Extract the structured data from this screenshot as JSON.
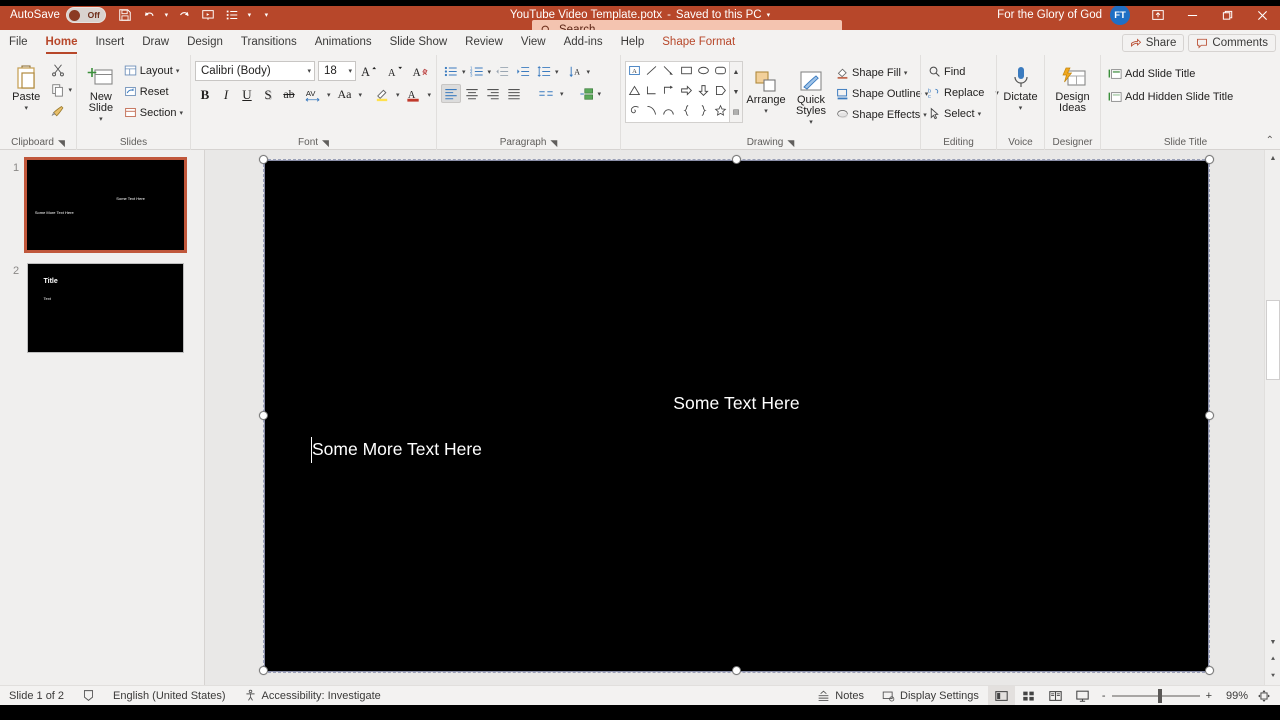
{
  "titlebar": {
    "autosave_label": "AutoSave",
    "autosave_state": "Off",
    "document_title": "YouTube Video Template.potx",
    "save_state": "Saved to this PC",
    "search_placeholder": "Search",
    "account_name": "For the Glory of God",
    "avatar_initials": "FT",
    "accent_color": "#b7472a",
    "qat": [
      {
        "name": "save-icon",
        "label": "Save"
      },
      {
        "name": "undo-icon",
        "label": "Undo"
      },
      {
        "name": "redo-icon",
        "label": "Redo"
      },
      {
        "name": "start-from-beginning-icon",
        "label": "Start From Beginning"
      },
      {
        "name": "customize-list-icon",
        "label": "Customize Quick Access Toolbar"
      }
    ],
    "window_controls": [
      "minimize",
      "restore",
      "close"
    ]
  },
  "tabs": [
    {
      "label": "File",
      "active": false
    },
    {
      "label": "Home",
      "active": true
    },
    {
      "label": "Insert",
      "active": false
    },
    {
      "label": "Draw",
      "active": false
    },
    {
      "label": "Design",
      "active": false
    },
    {
      "label": "Transitions",
      "active": false
    },
    {
      "label": "Animations",
      "active": false
    },
    {
      "label": "Slide Show",
      "active": false
    },
    {
      "label": "Review",
      "active": false
    },
    {
      "label": "View",
      "active": false
    },
    {
      "label": "Add-ins",
      "active": false
    },
    {
      "label": "Help",
      "active": false
    },
    {
      "label": "Shape Format",
      "active": false,
      "contextual": true
    }
  ],
  "tabs_right": {
    "share_label": "Share",
    "comments_label": "Comments"
  },
  "ribbon": {
    "groups": [
      {
        "name": "clipboard",
        "label": "Clipboard"
      },
      {
        "name": "slides",
        "label": "Slides"
      },
      {
        "name": "font",
        "label": "Font"
      },
      {
        "name": "paragraph",
        "label": "Paragraph"
      },
      {
        "name": "drawing",
        "label": "Drawing"
      },
      {
        "name": "editing",
        "label": "Editing"
      },
      {
        "name": "voice",
        "label": "Voice"
      },
      {
        "name": "designer",
        "label": "Designer"
      },
      {
        "name": "slide_title",
        "label": "Slide Title"
      }
    ],
    "clipboard": {
      "paste_label": "Paste",
      "cut_tooltip": "Cut",
      "copy_tooltip": "Copy",
      "format_painter_tooltip": "Format Painter"
    },
    "slides": {
      "new_slide_label": "New Slide",
      "layout_label": "Layout",
      "reset_label": "Reset",
      "section_label": "Section"
    },
    "font": {
      "font_name": "Calibri (Body)",
      "font_size": "18",
      "grow_font_tooltip": "Increase Font Size",
      "shrink_font_tooltip": "Decrease Font Size",
      "clear_formatting_tooltip": "Clear All Formatting",
      "bold": "B",
      "italic": "I",
      "underline": "U",
      "shadow": "S",
      "strikethrough": "ab",
      "char_spacing": "AV",
      "change_case": "Aa",
      "text_highlight_tooltip": "Text Highlight Color",
      "font_color_tooltip": "Font Color"
    },
    "paragraph": {
      "bullets_tooltip": "Bullets",
      "numbering_tooltip": "Numbering",
      "decrease_indent_tooltip": "Decrease List Level",
      "increase_indent_tooltip": "Increase List Level",
      "line_spacing_tooltip": "Line Spacing",
      "text_direction_tooltip": "Text Direction",
      "align_text_tooltip": "Align Text",
      "smartart_tooltip": "Convert to SmartArt",
      "align_left_tooltip": "Align Left",
      "center_tooltip": "Center",
      "align_right_tooltip": "Align Right",
      "justify_tooltip": "Justify",
      "columns_tooltip": "Add or Remove Columns"
    },
    "drawing": {
      "arrange_label": "Arrange",
      "quick_styles_label": "Quick Styles",
      "shape_fill_label": "Shape Fill",
      "shape_outline_label": "Shape Outline",
      "shape_effects_label": "Shape Effects"
    },
    "editing": {
      "find_label": "Find",
      "replace_label": "Replace",
      "select_label": "Select"
    },
    "voice": {
      "dictate_label": "Dictate"
    },
    "designer": {
      "design_ideas_label": "Design Ideas"
    },
    "slide_title": {
      "add_slide_title_label": "Add Slide Title",
      "add_hidden_slide_title_label": "Add Hidden Slide Title"
    }
  },
  "thumbnails": [
    {
      "number": "1",
      "selected": true,
      "text_a": "Some Text Here",
      "text_b": "Some More Text Here"
    },
    {
      "number": "2",
      "selected": false,
      "title": "Title",
      "body": "Text"
    }
  ],
  "slide": {
    "background_color": "#000000",
    "text_a": "Some Text Here",
    "text_b": "Some More Text Here",
    "text_color": "#ffffff",
    "selected": true
  },
  "statusbar": {
    "slide_counter": "Slide 1 of 2",
    "language": "English (United States)",
    "accessibility": "Accessibility: Investigate",
    "notes_label": "Notes",
    "display_settings_label": "Display Settings",
    "zoom_percent": "99%",
    "zoom_out_label": "-",
    "zoom_in_label": "+",
    "views": [
      {
        "name": "normal-view",
        "active": true
      },
      {
        "name": "slide-sorter-view",
        "active": false
      },
      {
        "name": "reading-view",
        "active": false
      },
      {
        "name": "slide-show-view",
        "active": false
      }
    ]
  }
}
